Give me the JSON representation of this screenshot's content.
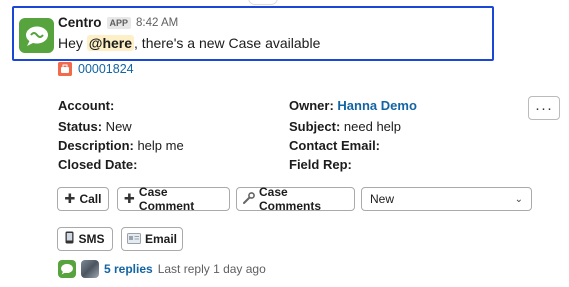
{
  "message": {
    "sender": "Centro",
    "badge": "APP",
    "time": "8:42 AM",
    "text_before": "Hey ",
    "mention": "@here",
    "text_after": ", there's a new Case available"
  },
  "case": {
    "number": "00001824",
    "icon": "briefcase-icon"
  },
  "fields": {
    "account_label": "Account:",
    "account_value": "",
    "status_label": "Status:",
    "status_value": " New",
    "description_label": "Description:",
    "description_value": " help me",
    "closed_date_label": "Closed Date:",
    "closed_date_value": "",
    "owner_label": "Owner:",
    "owner_value": "Hanna Demo",
    "subject_label": "Subject:",
    "subject_value": " need help",
    "contact_email_label": "Contact Email:",
    "contact_email_value": "",
    "field_rep_label": "Field Rep:",
    "field_rep_value": ""
  },
  "actions": {
    "more": "···",
    "call": "Call",
    "case_comment": "Case Comment",
    "case_comments": "Case Comments",
    "status_select": "New",
    "sms": "SMS",
    "email": "Email"
  },
  "thread": {
    "replies": "5 replies",
    "last_reply": "Last reply 1 day ago"
  },
  "colors": {
    "highlight": "#1a47d6",
    "brand": "#57a33d",
    "link": "#1264a3",
    "case_icon": "#f26a4c",
    "mention_bg": "#fdf0c6"
  }
}
